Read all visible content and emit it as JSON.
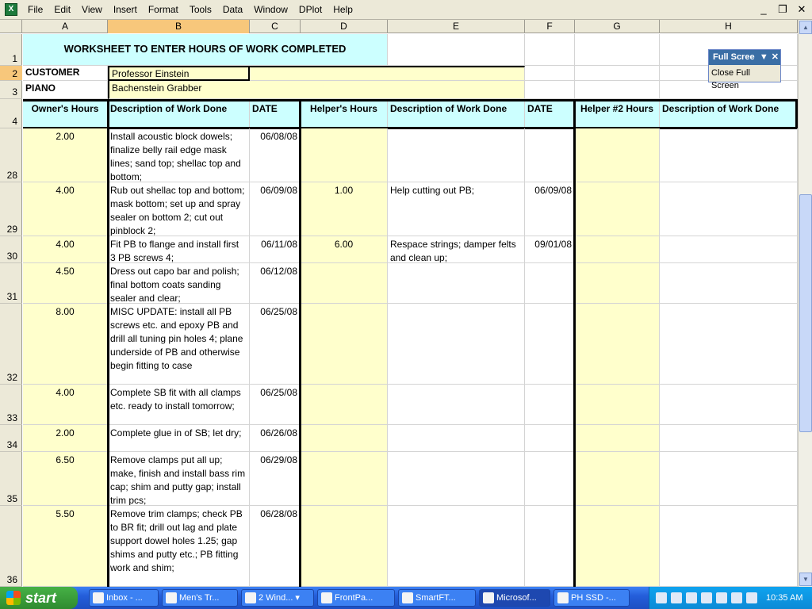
{
  "menu": [
    "File",
    "Edit",
    "View",
    "Insert",
    "Format",
    "Tools",
    "Data",
    "Window",
    "DPlot",
    "Help"
  ],
  "window_controls": [
    "_",
    "❐",
    "✕"
  ],
  "columns": [
    "A",
    "B",
    "C",
    "D",
    "E",
    "F",
    "G",
    "H"
  ],
  "selected_column": "B",
  "rows": [
    "1",
    "2",
    "3",
    "4",
    "28",
    "29",
    "30",
    "31",
    "32",
    "33",
    "34",
    "35",
    "36"
  ],
  "selected_row": "2",
  "sheet": {
    "title": "WORKSHEET TO ENTER HOURS OF WORK COMPLETED",
    "customer_label": "CUSTOMER",
    "customer_value": "Professor Einstein",
    "piano_label": "PIANO",
    "piano_value": "Bachenstein Grabber",
    "headers": [
      "Owner's Hours",
      "Description of Work Done",
      "DATE",
      "Helper's Hours",
      "Description of Work Done",
      "DATE",
      "Helper #2 Hours",
      "Description of Work Done"
    ],
    "records": [
      {
        "owner_hours": "2.00",
        "description": "Install acoustic block dowels; finalize belly rail edge mask lines; sand top; shellac top and bottom;",
        "date": "06/08/08",
        "helper_hours": "",
        "helper_description": "",
        "helper_date": ""
      },
      {
        "owner_hours": "4.00",
        "description": "Rub out shellac top and bottom; mask bottom; set up and spray sealer on bottom 2; cut out pinblock 2;",
        "date": "06/09/08",
        "helper_hours": "1.00",
        "helper_description": "Help cutting out PB;",
        "helper_date": "06/09/08"
      },
      {
        "owner_hours": "4.00",
        "description": "Fit PB to flange and install first 3 PB screws 4;",
        "date": "06/11/08",
        "helper_hours": "6.00",
        "helper_description": "Respace strings; damper felts and clean up;",
        "helper_date": "09/01/08"
      },
      {
        "owner_hours": "4.50",
        "description": "Dress out capo bar and polish; final bottom coats sanding sealer and clear;",
        "date": "06/12/08",
        "helper_hours": "",
        "helper_description": "",
        "helper_date": ""
      },
      {
        "owner_hours": "8.00",
        "description": "MISC UPDATE: install all PB screws etc. and epoxy PB and drill all tuning pin holes 4; plane underside of PB and otherwise begin fitting to case",
        "date": "06/25/08",
        "helper_hours": "",
        "helper_description": "",
        "helper_date": ""
      },
      {
        "owner_hours": "4.00",
        "description": "Complete SB fit with all clamps etc. ready to install tomorrow;",
        "date": "06/25/08",
        "helper_hours": "",
        "helper_description": "",
        "helper_date": ""
      },
      {
        "owner_hours": "2.00",
        "description": "Complete glue in of SB; let dry;",
        "date": "06/26/08",
        "helper_hours": "",
        "helper_description": "",
        "helper_date": ""
      },
      {
        "owner_hours": "6.50",
        "description": "Remove clamps put all up; make, finish and install bass rim cap; shim and putty gap; install trim pcs;",
        "date": "06/29/08",
        "helper_hours": "",
        "helper_description": "",
        "helper_date": ""
      },
      {
        "owner_hours": "5.50",
        "description": "Remove trim clamps; check PB to BR fit; drill out lag and plate support dowel holes 1.25; gap shims and putty etc.; PB fitting work and shim;",
        "date": "06/28/08",
        "helper_hours": "",
        "helper_description": "",
        "helper_date": ""
      }
    ]
  },
  "fullscreen_toolbar": {
    "title": "Full Scree",
    "button": "Close Full Screen"
  },
  "taskbar": {
    "start": "start",
    "tasks": [
      "Inbox - ...",
      "Men's Tr...",
      "2 Wind...",
      "FrontPa...",
      "SmartFT...",
      "Microsof...",
      "PH SSD -..."
    ],
    "active_task": "Microsof...",
    "clock": "10:35 AM"
  },
  "colors": {
    "yellow_fill": "#ffffcc",
    "cyan_fill": "#ccffff",
    "selection": "#f7c77b",
    "taskbar": "#245edb"
  }
}
